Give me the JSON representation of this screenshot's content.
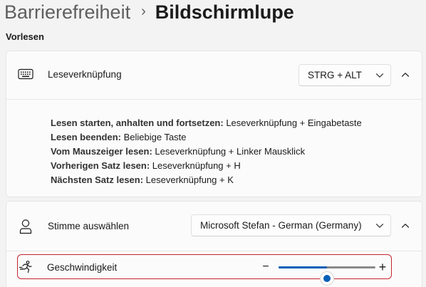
{
  "breadcrumb": {
    "parent": "Barrierefreiheit",
    "separator": "›",
    "current": "Bildschirmlupe"
  },
  "section": {
    "label": "Vorlesen"
  },
  "shortcut_card": {
    "icon": "keyboard-icon",
    "label": "Leseverknüpfung",
    "dropdown_value": "STRG + ALT",
    "expanded": true,
    "items": [
      {
        "key": "Lesen starten, anhalten und fortsetzen:",
        "value": " Leseverknüpfung + Eingabetaste"
      },
      {
        "key": "Lesen beenden:",
        "value": " Beliebige Taste"
      },
      {
        "key": "Vom Mauszeiger lesen:",
        "value": " Leseverknüpfung + Linker Mausklick"
      },
      {
        "key": "Vorherigen Satz lesen:",
        "value": " Leseverknüpfung + H"
      },
      {
        "key": "Nächsten Satz lesen:",
        "value": " Leseverknüpfung + K"
      }
    ]
  },
  "voice_card": {
    "icon": "person-icon",
    "label": "Stimme auswählen",
    "dropdown_value": "Microsoft Stefan - German (Germany)",
    "expanded": true
  },
  "speed_row": {
    "icon": "running-person-icon",
    "label": "Geschwindigkeit",
    "minus": "−",
    "plus": "+",
    "value_fraction": 0.5
  },
  "colors": {
    "accent": "#005fb8",
    "highlight_border": "#c4262e"
  }
}
